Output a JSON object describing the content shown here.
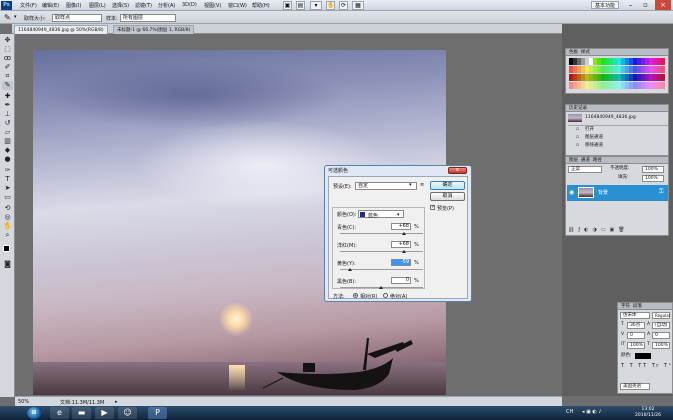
{
  "app": {
    "logo": "Ps"
  },
  "menu": [
    "文件(F)",
    "编辑(E)",
    "图像(I)",
    "图层(L)",
    "选择(S)",
    "滤镜(T)",
    "分析(A)",
    "3D(D)",
    "视图(V)",
    "窗口(W)",
    "帮助(H)"
  ],
  "workspace": "基本功能",
  "window_controls": [
    "minimize-icon",
    "maximize-icon",
    "close-icon"
  ],
  "options": {
    "size_label": "取样大小:",
    "size_value": "取样点",
    "sample_label": "样本:",
    "sample_value": "所有图层"
  },
  "doc_tabs": [
    "1164840949_4836.jpg @ 50%(RGB/8)",
    "未标题-1 @ 66.7%(图层 1, RGB/8)"
  ],
  "tools": [
    "move-icon",
    "marquee-icon",
    "lasso-icon",
    "quick-select-icon",
    "crop-icon",
    "eyedropper-icon",
    "healing-icon",
    "brush-icon",
    "clone-stamp-icon",
    "history-brush-icon",
    "eraser-icon",
    "gradient-icon",
    "blur-icon",
    "dodge-icon",
    "pen-icon",
    "type-icon",
    "path-select-icon",
    "shape-icon",
    "3d-rotate-icon",
    "3d-orbit-icon",
    "hand-icon",
    "zoom-icon",
    "color-swatch-icon",
    "quickmask-icon"
  ],
  "status": {
    "zoom": "50%",
    "doc": "文档:11.3M/11.3M"
  },
  "panels": {
    "swatches": {
      "tabs": [
        "色板",
        "样式"
      ]
    },
    "history": {
      "title": "历史记录",
      "snapshot": "1164840949_4836.jpg",
      "items": [
        "打开",
        "图层通道",
        "移除通道"
      ]
    },
    "layers": {
      "tabs": [
        "图层",
        "通道",
        "路径"
      ],
      "mode": "正常",
      "opacity_label": "不透明度:",
      "opacity": "100%",
      "fill_label": "填充:",
      "fill": "100%",
      "layer_name": "背景"
    },
    "character": {
      "tabs": [
        "字符",
        "段落"
      ],
      "font": "仿宋体",
      "style": "Regular",
      "size": "36点",
      "leading": "(自动)",
      "kern": "0",
      "track": "0",
      "vscale": "100%",
      "hscale": "100%",
      "color_label": "颜色:",
      "lang": "美国英语"
    }
  },
  "dialog": {
    "title": "可选颜色",
    "preset_label": "预设(E):",
    "preset_value": "自定",
    "color_label": "颜色(O):",
    "color_value": "蓝色",
    "ok": "确定",
    "cancel": "取消",
    "preview": "预览(P)",
    "sliders": [
      {
        "label": "青色(C):",
        "value": "+68",
        "unit": "%"
      },
      {
        "label": "洋红(M):",
        "value": "+68",
        "unit": "%"
      },
      {
        "label": "黄色(Y):",
        "value": "-59",
        "unit": "%"
      },
      {
        "label": "黑色(B):",
        "value": "0",
        "unit": "%"
      }
    ],
    "method_label": "方法:",
    "method_relative": "相对(R)",
    "method_absolute": "绝对(A)"
  },
  "taskbar": {
    "start": "⊞",
    "apps": [
      "ie-icon",
      "folder-icon",
      "media-player-icon",
      "messenger-icon",
      "photoshop-icon"
    ],
    "lang": "CH",
    "time": "13:02",
    "date": "2010/11/26"
  },
  "colors": {
    "accent": "#2f8fd0",
    "selected_layer": "#2a90d1"
  }
}
